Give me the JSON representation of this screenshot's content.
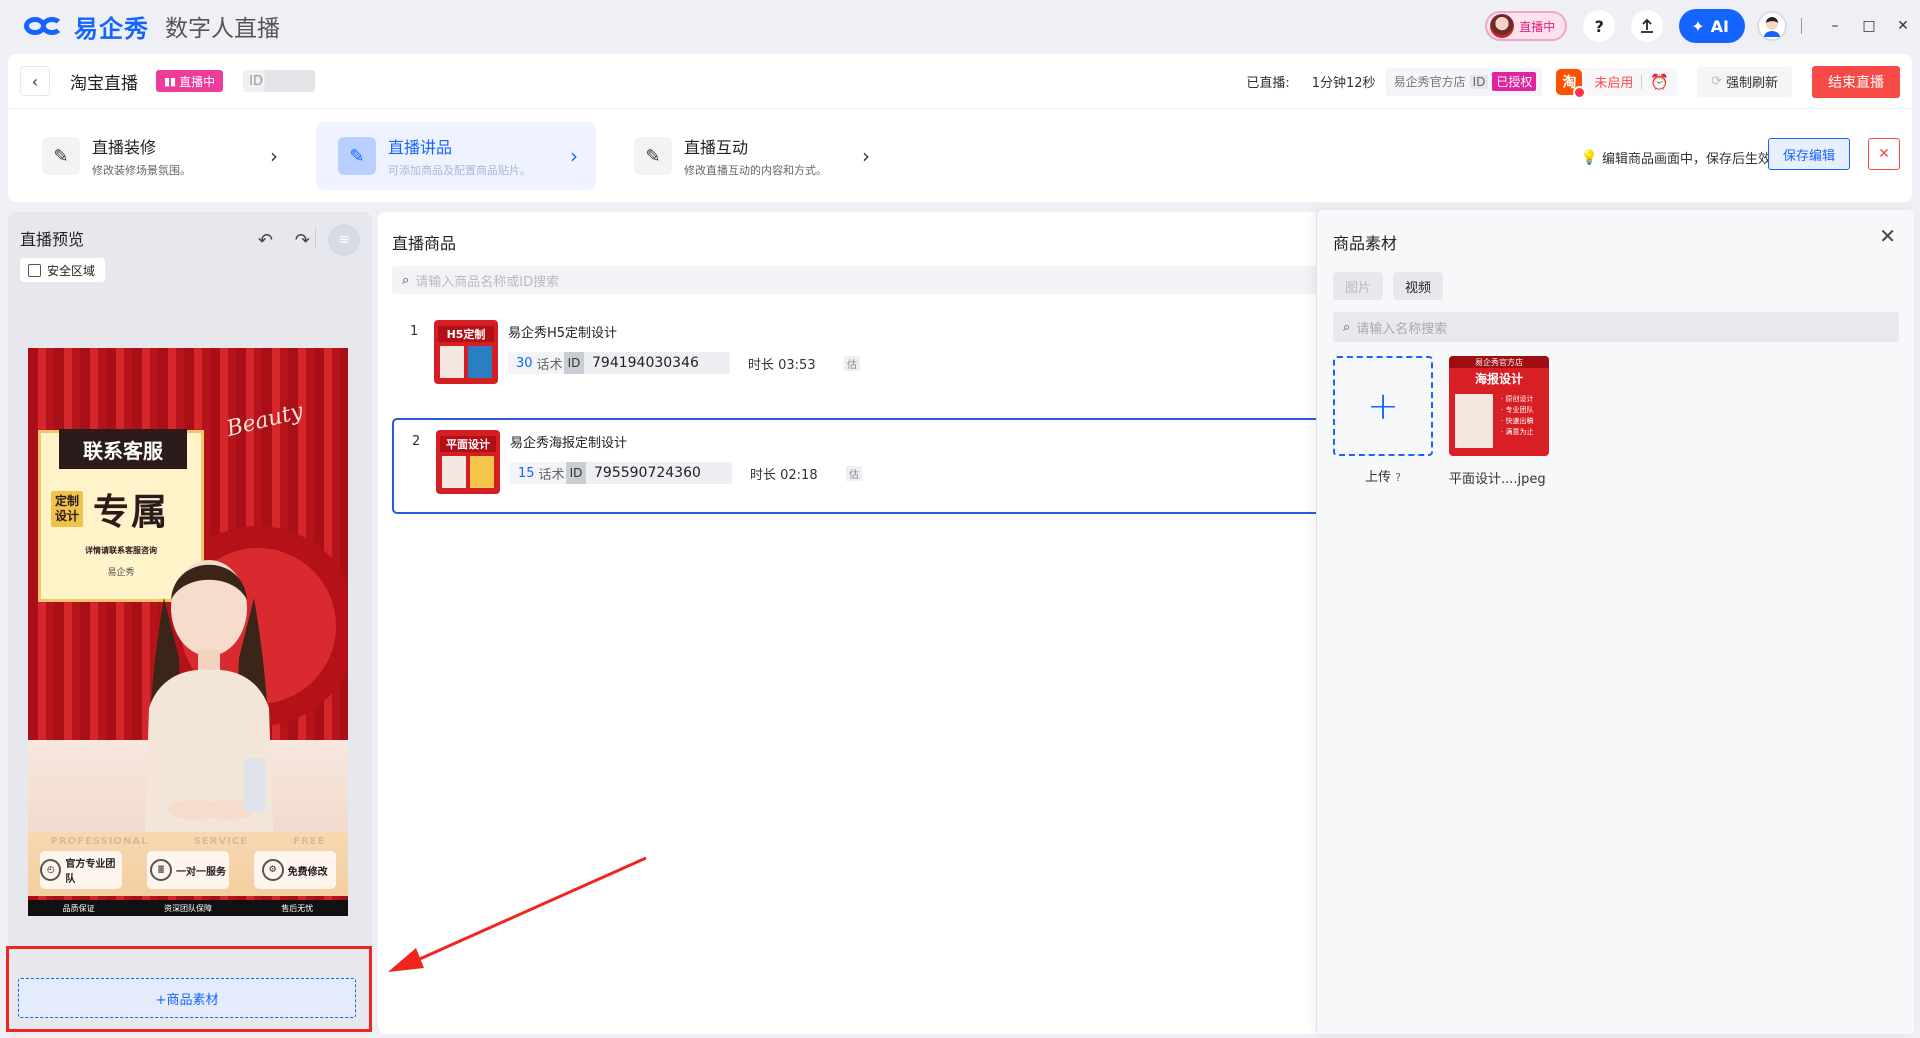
{
  "app": {
    "brand": "易企秀",
    "subtitle": "数字人直播",
    "live_pill": "直播中",
    "help": "?",
    "upload_icon": "upload-icon",
    "ai_label": "AI",
    "window": {
      "minimize": "–",
      "maximize": "□",
      "close": "✕"
    }
  },
  "header": {
    "back": "‹",
    "title": "淘宝直播",
    "live_tag": "直播中",
    "id_label": "ID",
    "elapsed_label": "已直播:",
    "elapsed_value": "1分钟12秒",
    "shop_name": "易企秀官方店",
    "shop_id_label": "ID",
    "auth_tag": "已授权",
    "taobao_icon": "淘",
    "taobao_state": "未启用",
    "refresh": "强制刷新",
    "end": "结束直播"
  },
  "steps": [
    {
      "title": "直播装修",
      "desc": "修改装修场景氛围。"
    },
    {
      "title": "直播讲品",
      "desc": "可添加商品及配置商品贴片。"
    },
    {
      "title": "直播互动",
      "desc": "修改直播互动的内容和方式。"
    }
  ],
  "edit_hint": "编辑商品画面中，保存后生效。",
  "save_edit": "保存编辑",
  "preview": {
    "title": "直播预览",
    "safe_area": "安全区域",
    "add_material": "+商品素材",
    "poster": {
      "beauty": "Beauty",
      "card_title": "联系客服",
      "card_small": "定制\n设计",
      "card_big": "专属",
      "card_desc": "详情请联系客服咨询",
      "card_logo": "易企秀",
      "feat_head": [
        "PROFESSIONAL",
        "SERVICE",
        "FREE"
      ],
      "features": [
        "官方专业团队",
        "一对一服务",
        "免费修改"
      ],
      "bottom": [
        "品质保证",
        "资深团队保障",
        "售后无忧"
      ]
    }
  },
  "products": {
    "title": "直播商品",
    "search_placeholder": "请输入商品名称或ID搜索",
    "items": [
      {
        "index": "1",
        "thumb_text": "H5定制",
        "name": "易企秀H5定制设计",
        "talk_count": "30",
        "talk_label": "话术",
        "id_label": "ID",
        "id": "794194030346",
        "duration": "时长 03:53",
        "est": "估"
      },
      {
        "index": "2",
        "thumb_text": "平面设计",
        "name": "易企秀海报定制设计",
        "talk_count": "15",
        "talk_label": "话术",
        "id_label": "ID",
        "id": "795590724360",
        "duration": "时长 02:18",
        "est": "估"
      }
    ]
  },
  "drawer": {
    "title": "商品素材",
    "tabs": [
      "图片",
      "视频"
    ],
    "search_placeholder": "请输入名称搜索",
    "upload_label": "上传",
    "upload_help": "?",
    "material": {
      "header": "易企秀官方店",
      "title": "海报设计",
      "lines": [
        "· 原创设计",
        "· 专业团队",
        "· 快速出稿",
        "· 满意为止"
      ],
      "name": "平面设计....jpeg"
    }
  },
  "colors": {
    "brand": "#1664ff",
    "live": "#ee3c9b",
    "end": "#f54a45",
    "annotation": "#f0261d"
  }
}
